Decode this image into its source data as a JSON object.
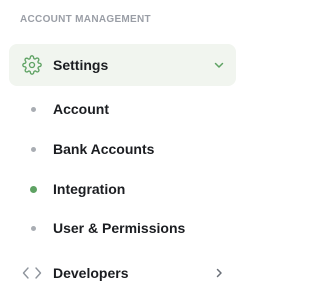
{
  "section_heading": "ACCOUNT MANAGEMENT",
  "settings": {
    "label": "Settings",
    "icon": "gear-icon",
    "chevron": "chevron-down-icon",
    "accent": "#5ea263"
  },
  "sub_items": [
    {
      "label": "Account",
      "state": "default"
    },
    {
      "label": "Bank Accounts",
      "state": "default"
    },
    {
      "label": "Integration",
      "state": "active"
    },
    {
      "label": "User & Permissions",
      "state": "hover"
    }
  ],
  "developers": {
    "label": "Developers",
    "icon": "code-icon",
    "chevron": "chevron-right-icon"
  }
}
